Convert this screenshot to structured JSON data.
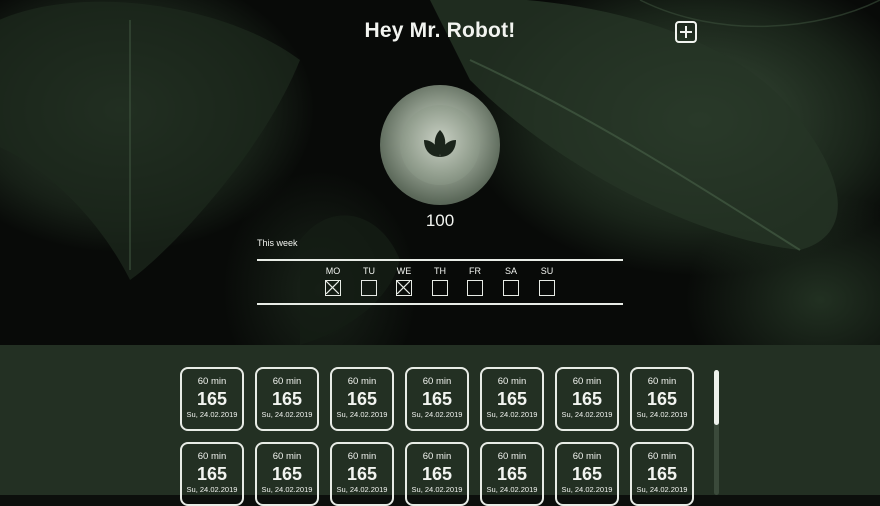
{
  "header": {
    "title": "Hey Mr. Robot!",
    "add_icon": "plus-square-icon"
  },
  "profile": {
    "icon": "lotus-icon",
    "score": "100"
  },
  "week": {
    "label": "This week",
    "days": [
      {
        "label": "MO",
        "checked": true
      },
      {
        "label": "TU",
        "checked": false
      },
      {
        "label": "WE",
        "checked": true
      },
      {
        "label": "TH",
        "checked": false
      },
      {
        "label": "FR",
        "checked": false
      },
      {
        "label": "SA",
        "checked": false
      },
      {
        "label": "SU",
        "checked": false
      }
    ]
  },
  "sessions": [
    {
      "duration": "60 min",
      "value": "165",
      "date": "Su, 24.02.2019"
    },
    {
      "duration": "60 min",
      "value": "165",
      "date": "Su, 24.02.2019"
    },
    {
      "duration": "60 min",
      "value": "165",
      "date": "Su, 24.02.2019"
    },
    {
      "duration": "60 min",
      "value": "165",
      "date": "Su, 24.02.2019"
    },
    {
      "duration": "60 min",
      "value": "165",
      "date": "Su, 24.02.2019"
    },
    {
      "duration": "60 min",
      "value": "165",
      "date": "Su, 24.02.2019"
    },
    {
      "duration": "60 min",
      "value": "165",
      "date": "Su, 24.02.2019"
    },
    {
      "duration": "60 min",
      "value": "165",
      "date": "Su, 24.02.2019"
    },
    {
      "duration": "60 min",
      "value": "165",
      "date": "Su, 24.02.2019"
    },
    {
      "duration": "60 min",
      "value": "165",
      "date": "Su, 24.02.2019"
    },
    {
      "duration": "60 min",
      "value": "165",
      "date": "Su, 24.02.2019"
    },
    {
      "duration": "60 min",
      "value": "165",
      "date": "Su, 24.02.2019"
    },
    {
      "duration": "60 min",
      "value": "165",
      "date": "Su, 24.02.2019"
    },
    {
      "duration": "60 min",
      "value": "165",
      "date": "Su, 24.02.2019"
    }
  ],
  "colors": {
    "accent": "#eef2ec",
    "panel": "#233023",
    "background": "#080a08"
  }
}
